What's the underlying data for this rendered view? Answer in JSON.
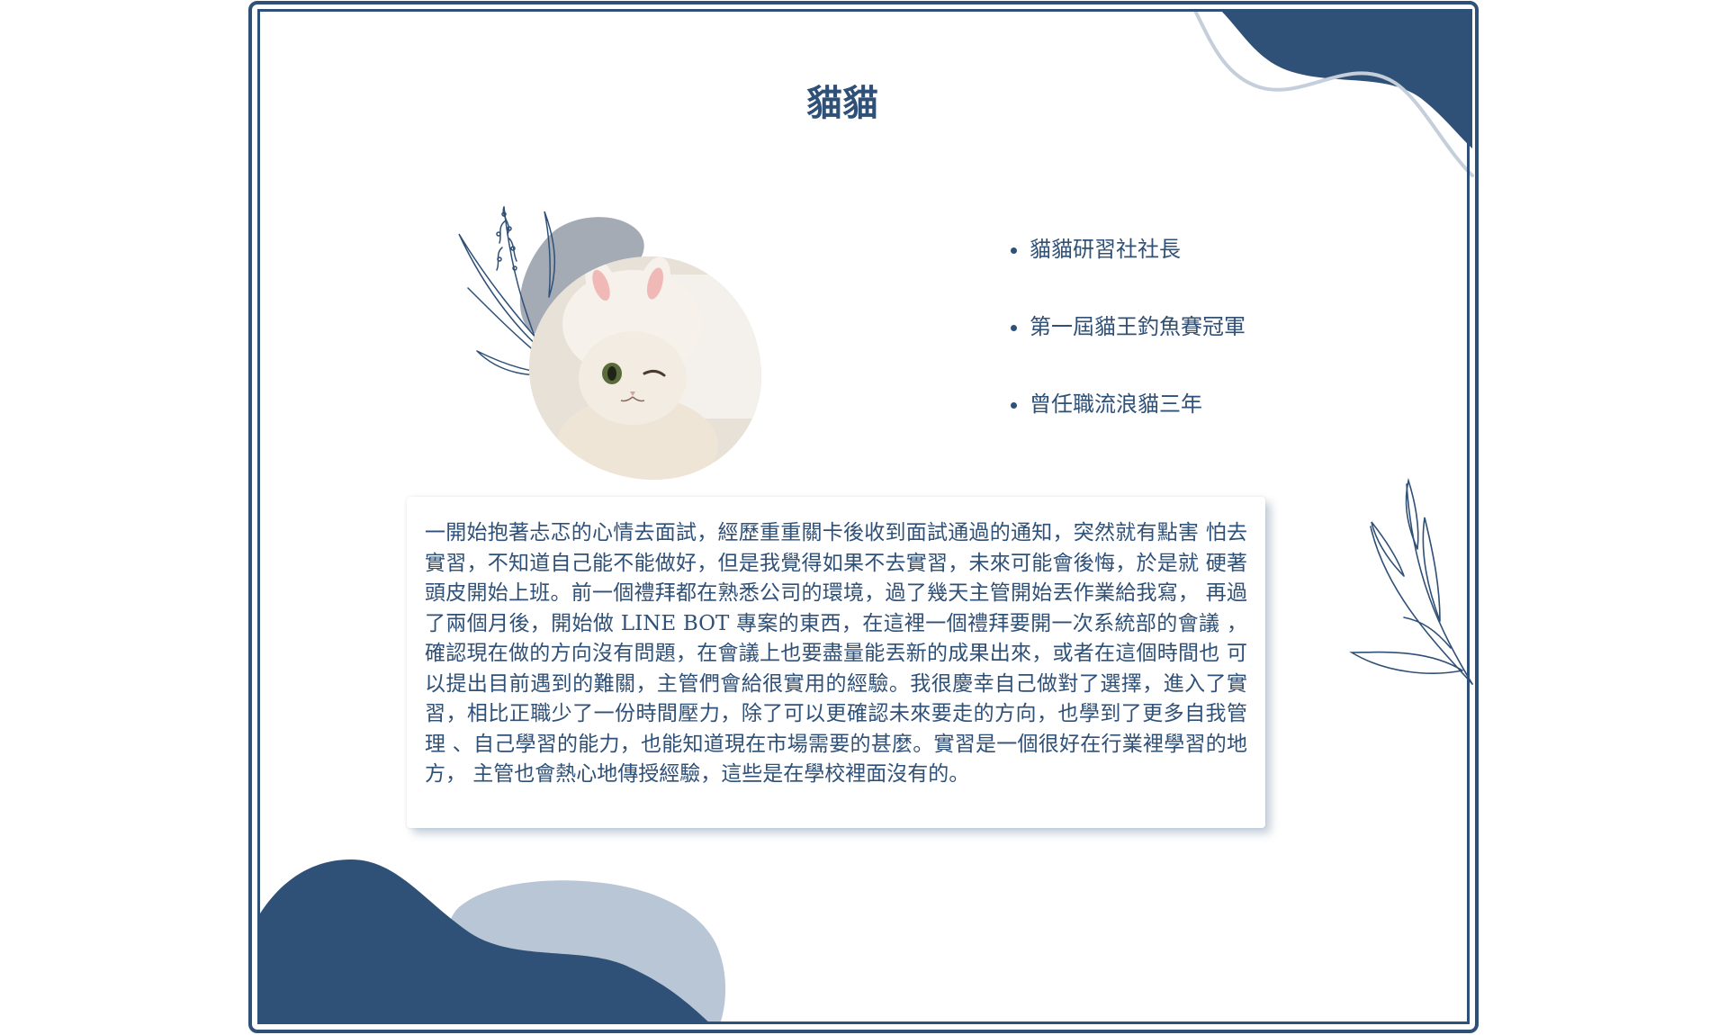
{
  "profile": {
    "title": "貓貓",
    "photo_alt": "cat-with-bunny-hat-photo",
    "roles": [
      "貓貓研習社社長",
      "第一屆貓王釣魚賽冠軍",
      "曾任職流浪貓三年"
    ],
    "story": "一開始抱著忐忑的心情去面試，經歷重重關卡後收到面試通過的通知，突然就有點害 怕去實習，不知道自己能不能做好，但是我覺得如果不去實習，未來可能會後悔，於是就 硬著頭皮開始上班。前一個禮拜都在熟悉公司的環境，過了幾天主管開始丟作業給我寫， 再過了兩個月後，開始做 LINE BOT 專案的東西，在這裡一個禮拜要開一次系統部的會議 ，確認現在做的方向沒有問題，在會議上也要盡量能丟新的成果出來，或者在這個時間也 可以提出目前遇到的難關，主管們會給很實用的經驗。我很慶幸自己做對了選擇，進入了實 習，相比正職少了一份時間壓力，除了可以更確認未來要走的方向，也學到了更多自我管理 、自己學習的能力，也能知道現在市場需要的甚麼。實習是一個很好在行業裡學習的地方， 主管也會熱心地傳授經驗，這些是在學校裡面沒有的。"
  },
  "theme": {
    "primary": "#2f5077",
    "light_blob": "#b9c6d6",
    "gray_blob": "#9aa2ac",
    "background": "#ffffff"
  },
  "decorations": {
    "icons": [
      "leaf-sprig-icon",
      "wave-blob-icon",
      "cat-photo"
    ]
  }
}
